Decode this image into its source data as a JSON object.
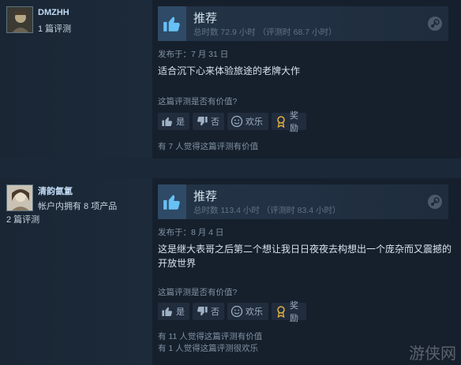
{
  "reviews": [
    {
      "user": {
        "name": "DMZHH",
        "reviews_count": "1 篇评测"
      },
      "verdict": "推荐",
      "hours": "总时数 72.9 小时  （评测时 68.7 小时）",
      "posted": "发布于：7 月 31 日",
      "text": "适合沉下心来体验旅途的老牌大作",
      "question": "这篇评测是否有价值?",
      "buttons": {
        "yes": "是",
        "no": "否",
        "funny": "欢乐",
        "award": "奖励"
      },
      "helpful": [
        "有 7 人觉得这篇评测有价值"
      ]
    },
    {
      "user": {
        "name": "清韵氤氲",
        "products": "帐户内拥有 8 项产品",
        "reviews_count": "2 篇评测"
      },
      "verdict": "推荐",
      "hours": "总时数 113.4 小时  （评测时 83.4 小时）",
      "posted": "发布于：8 月 4 日",
      "text": "这是继大表哥之后第二个想让我日日夜夜去构想出一个庞杂而又震撼的开放世界",
      "question": "这篇评测是否有价值?",
      "buttons": {
        "yes": "是",
        "no": "否",
        "funny": "欢乐",
        "award": "奖励"
      },
      "helpful": [
        "有 11 人觉得这篇评测有价值",
        "有 1 人觉得这篇评测很欢乐"
      ]
    }
  ],
  "watermark": "游侠网"
}
